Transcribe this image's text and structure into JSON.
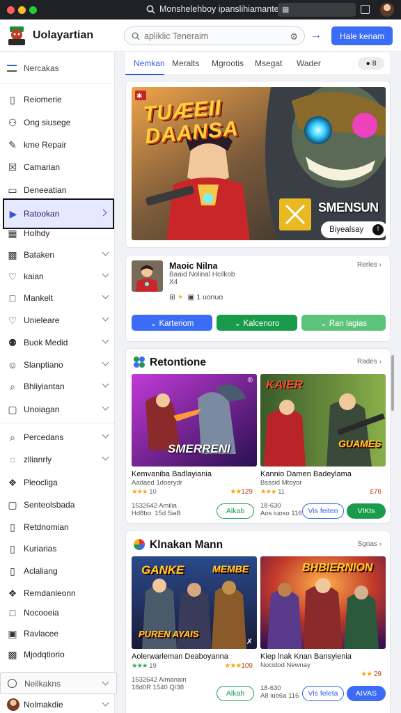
{
  "titlebar": {
    "search_text": "Monshelehboy ipanslihiamanterii",
    "box_text": "",
    "colors": {
      "close": "#fe5f57",
      "minimize": "#febc2e",
      "maximize": "#28c840"
    }
  },
  "header": {
    "brand": "Uolayartian",
    "search_placeholder": "apliklic Teneraim",
    "primary_button": "Hale kenam",
    "accent": "#3b6cf6"
  },
  "sidebar": {
    "top_label": "Nercakas",
    "items": [
      {
        "label": "Reiomerie",
        "icon": "document-icon"
      },
      {
        "label": "Ong siusege",
        "icon": "user-icon"
      },
      {
        "label": "kme Repair",
        "icon": "edit-icon"
      },
      {
        "label": "Camarian",
        "icon": "pencil-box-icon"
      },
      {
        "label": "Deneeatian",
        "icon": "window-icon"
      },
      {
        "label": "Ratookan",
        "icon": "play-icon",
        "active": true
      },
      {
        "label": "Holhdy",
        "icon": "calendar-icon"
      },
      {
        "label": "Bataken",
        "icon": "grid-icon"
      },
      {
        "label": "kaian",
        "icon": "heart-icon"
      },
      {
        "label": "Mankelt",
        "icon": "square-icon"
      },
      {
        "label": "Unieleare",
        "icon": "heart-icon"
      },
      {
        "label": "Buok Medid",
        "icon": "users-icon"
      },
      {
        "label": "Slanptiano",
        "icon": "smile-icon"
      },
      {
        "label": "Bhliyiantan",
        "icon": "search-icon"
      },
      {
        "label": "Unoiagan",
        "icon": "file-icon"
      }
    ],
    "items2": [
      {
        "label": "Percedans",
        "icon": "search-icon"
      },
      {
        "label": "zllianrly",
        "icon": "circle-icon"
      },
      {
        "label": "Pleocliga",
        "icon": "puzzle-icon"
      },
      {
        "label": "Senteolsbada",
        "icon": "file-icon"
      },
      {
        "label": "Retdnomian",
        "icon": "document-icon"
      },
      {
        "label": "Kuriarias",
        "icon": "document-icon"
      },
      {
        "label": "Aclaliang",
        "icon": "document-icon"
      },
      {
        "label": "Remdanleonn",
        "icon": "puzzle-icon"
      },
      {
        "label": "Nocooeia",
        "icon": "square-icon"
      },
      {
        "label": "Ravlacee",
        "icon": "image-icon"
      },
      {
        "label": "Mjodqtiorio",
        "icon": "grid-icon"
      }
    ],
    "bottom_select": "Neilkakns",
    "profile": "Nolmakdie"
  },
  "tabs": {
    "items": [
      "Nemkan",
      "Meralts",
      "Mgrootis",
      "Msegat",
      "Wader"
    ],
    "active_index": 0,
    "badge": "8"
  },
  "banner": {
    "title_line1": "TUÆEII",
    "title_line2": "DAANSA",
    "subtitle": "SMENSUN",
    "button": "Biyealsay"
  },
  "app": {
    "name": "Maoic Nilna",
    "sub1": "Baaid Nolinal Hcilkob",
    "sub2": "X4",
    "meta": "1 uonuo",
    "link": "Rerles",
    "buttons": [
      "Karteriom",
      "Kalcenoro",
      "Ran lagias"
    ],
    "button_colors": [
      "#3b6cf6",
      "#1a9b4b",
      "#5cc47a"
    ]
  },
  "section1": {
    "title": "Retontione",
    "link": "Rades",
    "cards": [
      {
        "image_text": "SMERRENI",
        "title": "Kemvaniba Badlayiania",
        "sub": "Aadaed 1doerydr",
        "rating": "10",
        "value": "129",
        "stars": "★★★",
        "dl1": "1532642  Amilia",
        "dl2": "Hd8bo. 15d 5iaB",
        "btn1": "Alkab",
        "btn2": ""
      },
      {
        "image_text": "GUAMES",
        "image_text2": "KAIER",
        "title": "Kannio Damen Badeylama",
        "sub": "Bsssid Mtoyor",
        "rating": "11",
        "value": "£76",
        "stars": "★★★",
        "dl1": "18-630",
        "dl2": "Aos iuoso 116",
        "btn1": "Vis feiten",
        "btn2": "VIKts"
      }
    ]
  },
  "section2": {
    "title": "Klnakan Mann",
    "link": "Sgnas",
    "cards": [
      {
        "image_text": "GANKE",
        "image_text2": "MEMBE",
        "image_text3": "PUREN AYAIS",
        "title": "Aolerwarleman Deaboyanna",
        "sub": "",
        "rating": "19",
        "value": "109",
        "stars": "★★★",
        "dl1": "1532642  Aimanain",
        "dl2": "18d0R  1540 Q/38",
        "btn1": "Alkah",
        "btn2": ""
      },
      {
        "image_text": "BHBIERNION",
        "title": "Kiep lnak Knan Bansyienia",
        "sub": "Nocidod Newnay",
        "rating": "",
        "value": "29",
        "stars": "★★",
        "dl1": "18-630",
        "dl2": "A8 iuo6a 116",
        "btn1": "Vis feleta",
        "btn2": "AIVAS"
      }
    ]
  }
}
